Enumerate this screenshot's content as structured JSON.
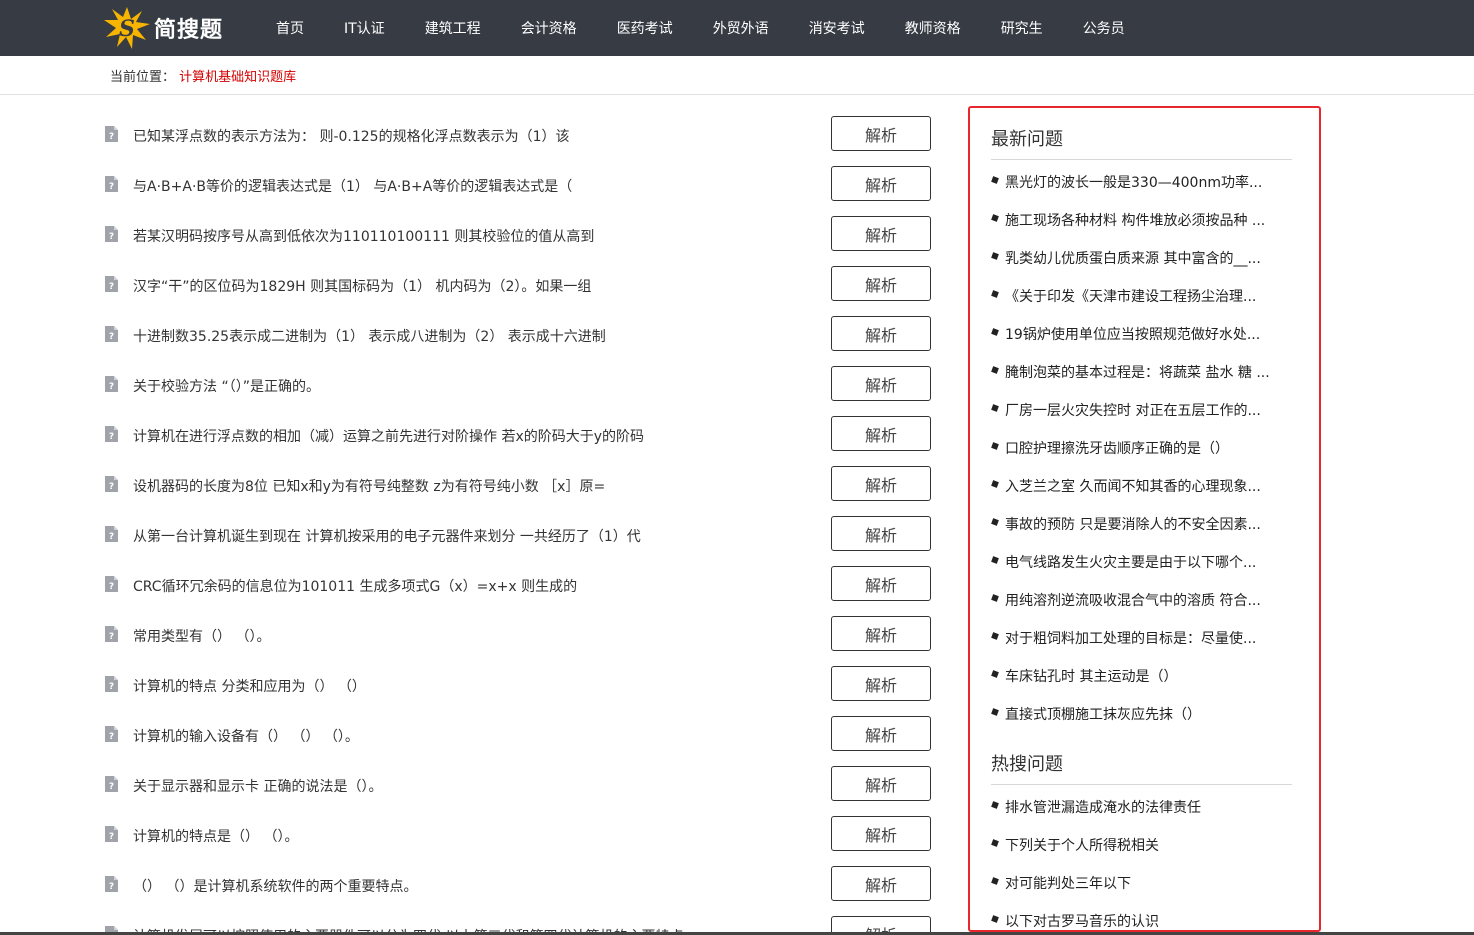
{
  "brand": {
    "name": "简搜题",
    "logo_letter": "S"
  },
  "nav": [
    {
      "label": "首页"
    },
    {
      "label": "IT认证"
    },
    {
      "label": "建筑工程"
    },
    {
      "label": "会计资格"
    },
    {
      "label": "医药考试"
    },
    {
      "label": "外贸外语"
    },
    {
      "label": "消安考试"
    },
    {
      "label": "教师资格"
    },
    {
      "label": "研究生"
    },
    {
      "label": "公务员"
    }
  ],
  "breadcrumb": {
    "prefix": "当前位置：",
    "current": "计算机基础知识题库"
  },
  "questions": [
    {
      "text": "已知某浮点数的表示方法为： 则-0.125的规格化浮点数表示为（1）该",
      "button": "解析"
    },
    {
      "text": "与A·B+A·B等价的逻辑表达式是（1） 与A·B+A等价的逻辑表达式是（",
      "button": "解析"
    },
    {
      "text": "若某汉明码按序号从高到低依次为110110100111 则其校验位的值从高到",
      "button": "解析"
    },
    {
      "text": "汉字“干”的区位码为1829H 则其国标码为（1） 机内码为（2）。如果一组",
      "button": "解析"
    },
    {
      "text": "十进制数35.25表示成二进制为（1） 表示成八进制为（2） 表示成十六进制",
      "button": "解析"
    },
    {
      "text": "关于校验方法 “（）”是正确的。",
      "button": "解析"
    },
    {
      "text": "计算机在进行浮点数的相加（减）运算之前先进行对阶操作 若x的阶码大于y的阶码",
      "button": "解析"
    },
    {
      "text": "设机器码的长度为8位 已知x和y为有符号纯整数 z为有符号纯小数 ［x］原=",
      "button": "解析"
    },
    {
      "text": "从第一台计算机诞生到现在 计算机按采用的电子元器件来划分 一共经历了（1）代",
      "button": "解析"
    },
    {
      "text": "CRC循环冗余码的信息位为101011 生成多项式G（x）=x+x 则生成的",
      "button": "解析"
    },
    {
      "text": "常用类型有（） （）。",
      "button": "解析"
    },
    {
      "text": "计算机的特点 分类和应用为（） （）",
      "button": "解析"
    },
    {
      "text": "计算机的输入设备有（） （） （）。",
      "button": "解析"
    },
    {
      "text": "关于显示器和显示卡 正确的说法是（）。",
      "button": "解析"
    },
    {
      "text": "计算机的特点是（） （）。",
      "button": "解析"
    },
    {
      "text": "（） （）是计算机系统软件的两个重要特点。",
      "button": "解析"
    },
    {
      "text": "计算机发展可以按照使用的主要器件可以分为四代 以上第三代和第四代计算机的主要特点",
      "button": "解析"
    }
  ],
  "sidebar": {
    "latest_title": "最新问题",
    "latest": [
      "黑光灯的波长一般是330—400nm功率...",
      "施工现场各种材料 构件堆放必须按品种 ...",
      "乳类幼儿优质蛋白质来源 其中富含的__...",
      "《关于印发《天津市建设工程扬尘治理...",
      "19锅炉使用单位应当按照规范做好水处...",
      "腌制泡菜的基本过程是：将蔬菜 盐水 糖 ...",
      "厂房一层火灾失控时 对正在五层工作的...",
      "口腔护理擦洗牙齿顺序正确的是（）",
      "入芝兰之室 久而闻不知其香的心理现象...",
      "事故的预防 只是要消除人的不安全因素...",
      "电气线路发生火灾主要是由于以下哪个...",
      "用纯溶剂逆流吸收混合气中的溶质 符合...",
      "对于粗饲料加工处理的目标是：尽量使...",
      "车床钻孔时 其主运动是（）",
      "直接式顶棚施工抹灰应先抹（）"
    ],
    "hot_title": "热搜问题",
    "hot": [
      "排水管泄漏造成淹水的法律责任",
      "下列关于个人所得税相关",
      "对可能判处三年以下",
      "以下对古罗马音乐的认识"
    ]
  },
  "colors": {
    "nav_bg": "#373c44",
    "breadcrumb_current": "#d40000",
    "sidebar_border": "#e8262d",
    "logo_yellow": "#f7b500"
  }
}
